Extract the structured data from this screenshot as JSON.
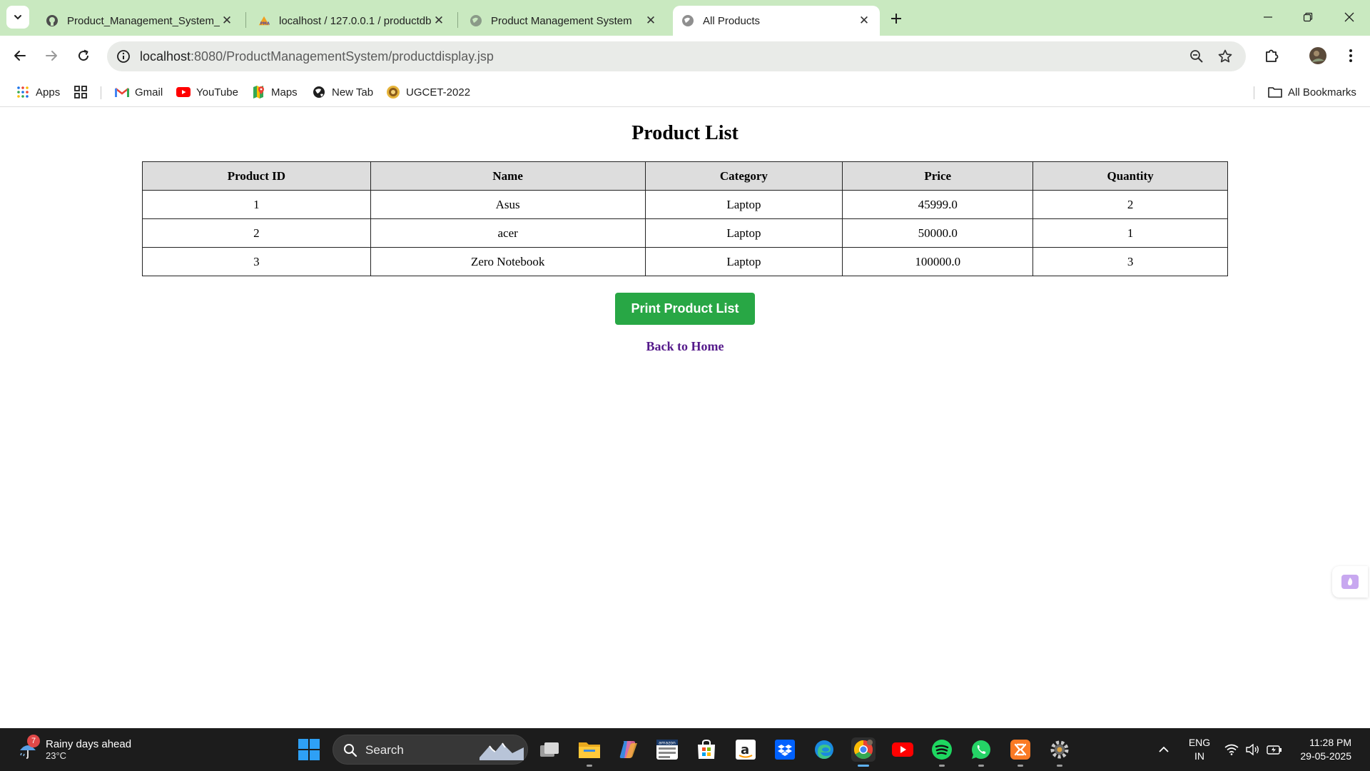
{
  "browser": {
    "tabs": [
      {
        "title": "Product_Management_System_",
        "favicon": "github-icon",
        "active": false
      },
      {
        "title": "localhost / 127.0.0.1 / productdb",
        "favicon": "phpmyadmin-icon",
        "active": false
      },
      {
        "title": "Product Management System",
        "favicon": "globe-icon",
        "active": false
      },
      {
        "title": "All Products",
        "favicon": "globe-icon",
        "active": true
      }
    ],
    "address": {
      "host": "localhost",
      "path": ":8080/ProductManagementSystem/productdisplay.jsp"
    },
    "bookmarks": [
      {
        "label": "Apps",
        "icon": "apps-grid-icon"
      },
      {
        "label": "Gmail",
        "icon": "gmail-icon"
      },
      {
        "label": "YouTube",
        "icon": "youtube-icon"
      },
      {
        "label": "Maps",
        "icon": "maps-icon"
      },
      {
        "label": "New Tab",
        "icon": "globe-icon"
      },
      {
        "label": "UGCET-2022",
        "icon": "ugcet-icon"
      }
    ],
    "all_bookmarks_label": "All Bookmarks",
    "tab_strip_color": "#c9e9c0"
  },
  "page": {
    "title": "Product List",
    "table": {
      "headers": [
        "Product ID",
        "Name",
        "Category",
        "Price",
        "Quantity"
      ],
      "rows": [
        [
          "1",
          "Asus",
          "Laptop",
          "45999.0",
          "2"
        ],
        [
          "2",
          "acer",
          "Laptop",
          "50000.0",
          "1"
        ],
        [
          "3",
          "Zero Notebook",
          "Laptop",
          "100000.0",
          "3"
        ]
      ]
    },
    "print_button_label": "Print Product List",
    "print_button_color": "#28a745",
    "back_link_label": "Back to Home"
  },
  "taskbar": {
    "weather": {
      "headline": "Rainy days ahead",
      "temp": "23°C",
      "badge": "7"
    },
    "search_label": "Search",
    "apps": [
      "task-view-icon",
      "file-explorer-icon",
      "copilot-icon",
      "amazon-news-icon",
      "microsoft-store-icon",
      "amazon-icon",
      "dropbox-icon",
      "edge-icon",
      "chrome-icon",
      "youtube-icon",
      "spotify-icon",
      "whatsapp-icon",
      "xampp-icon",
      "settings-icon"
    ],
    "language": {
      "line1": "ENG",
      "line2": "IN"
    },
    "time": "11:28 PM",
    "date": "29-05-2025"
  }
}
